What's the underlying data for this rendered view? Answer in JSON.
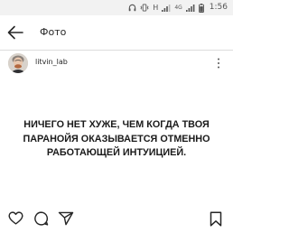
{
  "status_bar": {
    "network_label": "H",
    "sim2_label": "4G",
    "time": "1:56",
    "icons": [
      "headphones-icon",
      "vibrate-icon",
      "signal-icon",
      "signal-icon",
      "battery-icon"
    ]
  },
  "app_bar": {
    "title": "Фото",
    "back_icon": "arrow-left-icon"
  },
  "post": {
    "username": "litvin_lab",
    "avatar_icon": "avatar",
    "more_icon": "more-vertical-icon",
    "text_lines": [
      "НИЧЕГО НЕТ ХУЖЕ, ЧЕМ КОГДА ТВОЯ",
      "ПАРАНОЙЯ ОКАЗЫВАЕТСЯ ОТМЕННО",
      "РАБОТАЮЩЕЙ ИНТУИЦИЕЙ."
    ]
  },
  "actions": {
    "icons": [
      "heart-icon",
      "comment-icon",
      "share-icon",
      "bookmark-icon"
    ]
  },
  "colors": {
    "status_bar_bg": "#f2f2f2",
    "text": "#262626",
    "divider": "#dcdcdc"
  }
}
